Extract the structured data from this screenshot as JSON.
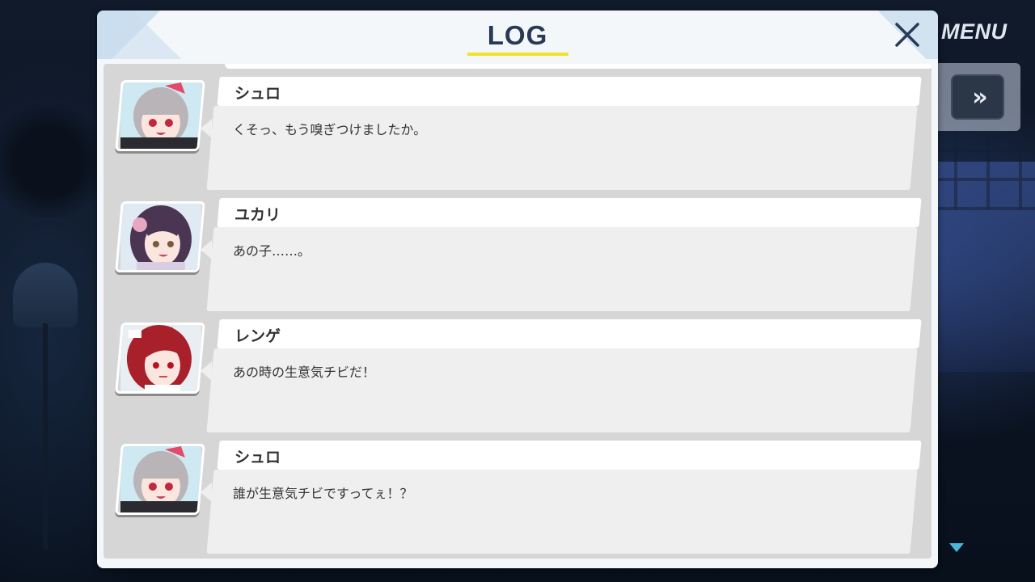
{
  "hud": {
    "menu_label": "MENU",
    "fast_forward_label": "»"
  },
  "panel": {
    "title": "LOG",
    "accent_color": "#f1e229",
    "title_color": "#283a55"
  },
  "entries": [
    {
      "name": "シュロ",
      "text": "くそっ、もう嗅ぎつけましたか。",
      "portrait": "shuro-portrait"
    },
    {
      "name": "ユカリ",
      "text": "あの子……。",
      "portrait": "yukari-portrait"
    },
    {
      "name": "レンゲ",
      "text": "あの時の生意気チビだ！",
      "portrait": "renge-portrait"
    },
    {
      "name": "シュロ",
      "text": "誰が生意気チビですってぇ！？",
      "portrait": "shuro-portrait"
    }
  ]
}
